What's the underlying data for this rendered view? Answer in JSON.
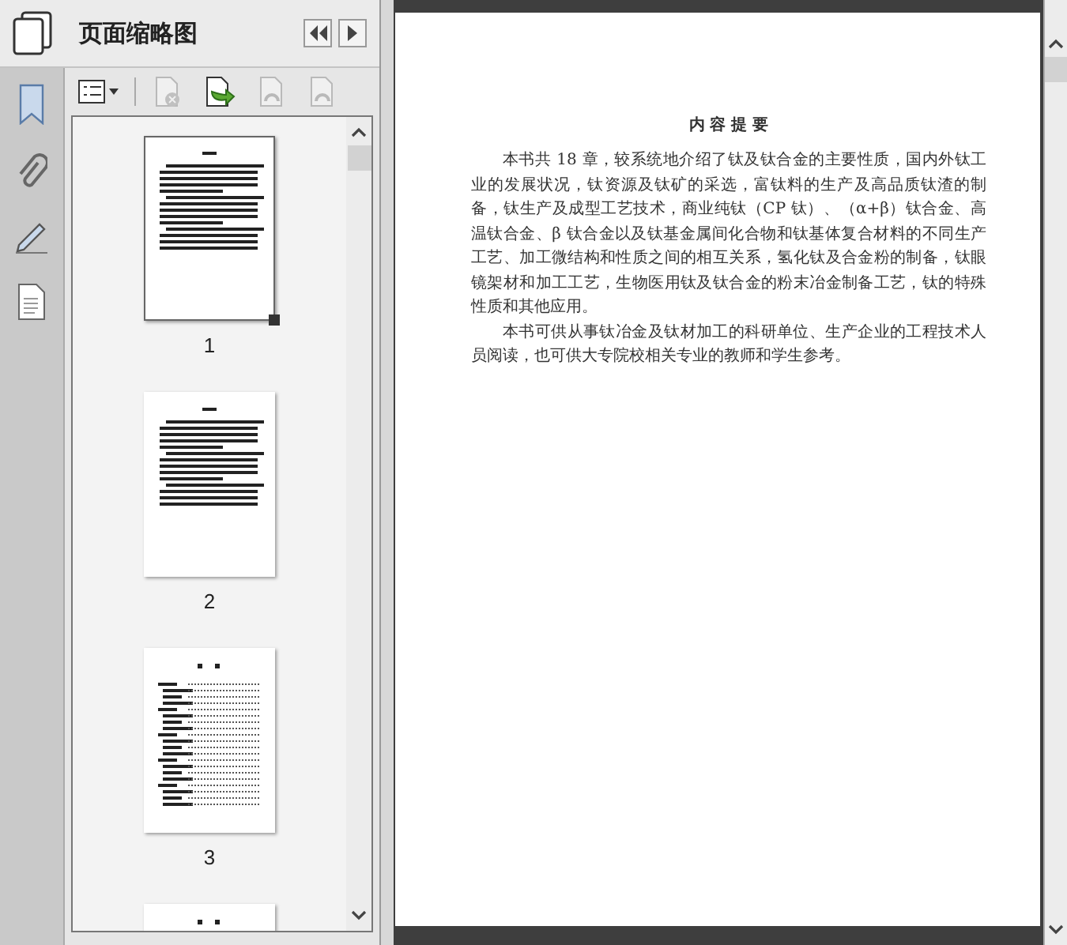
{
  "panel": {
    "title": "页面缩略图"
  },
  "toolbar": [
    {
      "kind": "options",
      "disabled": false
    },
    {
      "kind": "delete",
      "disabled": true
    },
    {
      "kind": "insert",
      "disabled": false
    },
    {
      "kind": "undo",
      "disabled": true
    },
    {
      "kind": "redo",
      "disabled": true
    }
  ],
  "thumbnails": [
    {
      "kind": "text",
      "page": "1",
      "selected": true
    },
    {
      "kind": "text",
      "page": "2",
      "selected": false
    },
    {
      "kind": "toc",
      "page": "3",
      "selected": false
    },
    {
      "kind": "toc",
      "selected": false
    }
  ],
  "document": {
    "title": "内 容 提 要",
    "paragraphs": [
      "本书共 18 章，较系统地介绍了钛及钛合金的主要性质，国内外钛工业的发展状况，钛资源及钛矿的采选，富钛料的生产及高品质钛渣的制备，钛生产及成型工艺技术，商业纯钛（CP 钛）、（α+β）钛合金、高温钛合金、β 钛合金以及钛基金属间化合物和钛基体复合材料的不同生产工艺、加工微结构和性质之间的相互关系，氢化钛及合金粉的制备，钛眼镜架材和加工工艺，生物医用钛及钛合金的粉末冶金制备工艺，钛的特殊性质和其他应用。",
      "本书可供从事钛冶金及钛材加工的科研单位、生产企业的工程技术人员阅读，也可供大专院校相关专业的教师和学生参考。"
    ]
  }
}
